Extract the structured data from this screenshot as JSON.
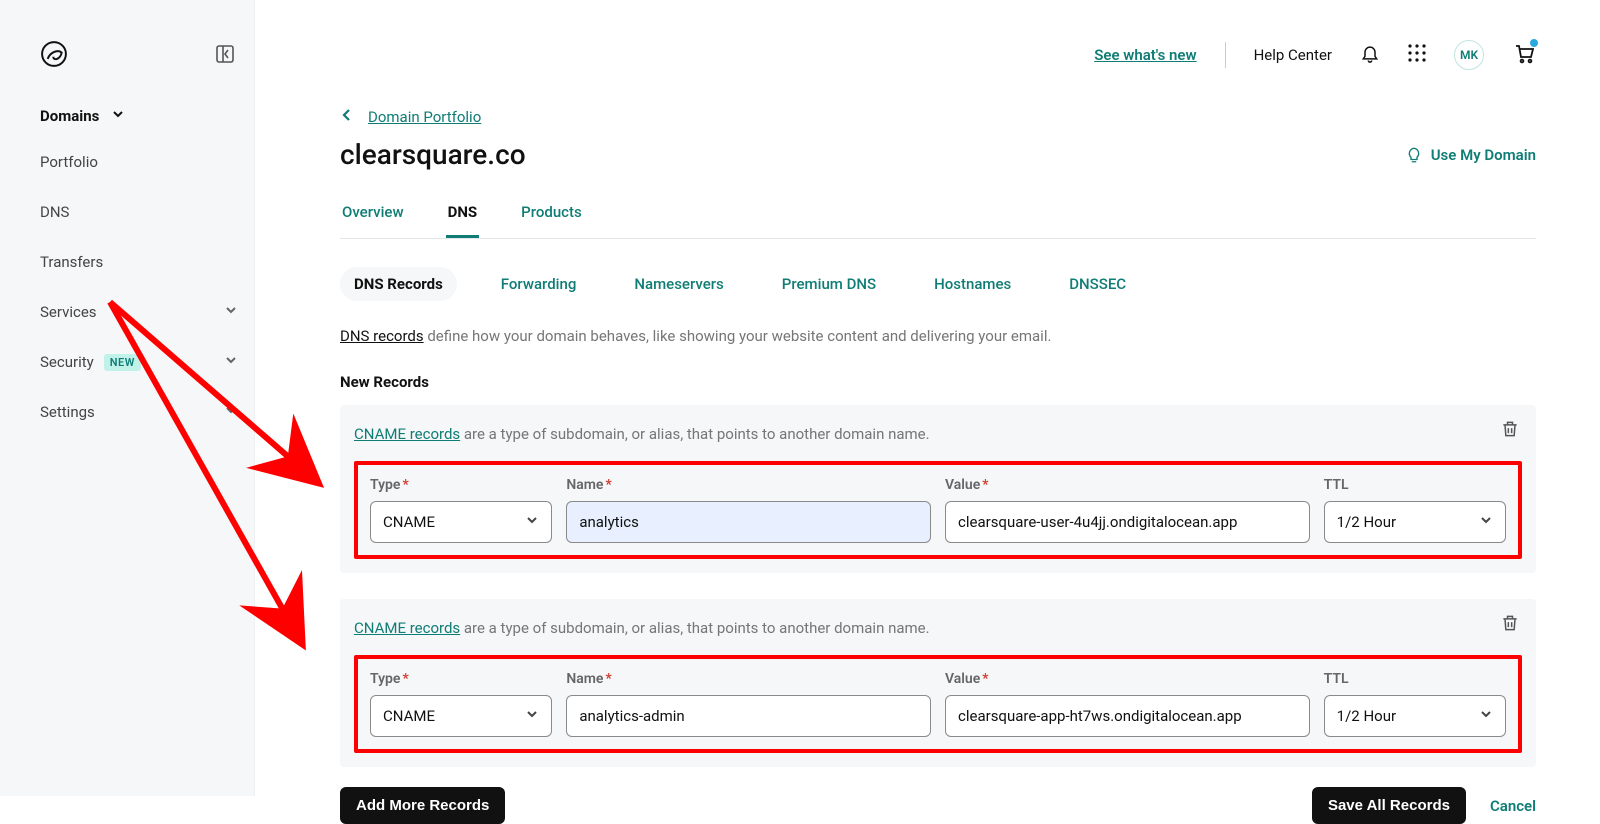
{
  "sidebar": {
    "section_title": "Domains",
    "items": [
      {
        "label": "Portfolio"
      },
      {
        "label": "DNS"
      },
      {
        "label": "Transfers"
      },
      {
        "label": "Services"
      },
      {
        "label": "Security",
        "badge": "NEW"
      },
      {
        "label": "Settings"
      }
    ]
  },
  "topbar": {
    "whats_new": "See what's new",
    "help_center": "Help Center",
    "avatar_initials": "MK"
  },
  "breadcrumb": {
    "back_label": "Domain Portfolio"
  },
  "domain": {
    "name": "clearsquare.co",
    "use_domain_label": "Use My Domain"
  },
  "tabs": [
    {
      "label": "Overview"
    },
    {
      "label": "DNS"
    },
    {
      "label": "Products"
    }
  ],
  "subtabs": [
    {
      "label": "DNS Records"
    },
    {
      "label": "Forwarding"
    },
    {
      "label": "Nameservers"
    },
    {
      "label": "Premium DNS"
    },
    {
      "label": "Hostnames"
    },
    {
      "label": "DNSSEC"
    }
  ],
  "info": {
    "link_text": "DNS records",
    "rest": " define how your domain behaves, like showing your website content and delivering your email."
  },
  "new_records_label": "New Records",
  "cname_tip": {
    "link": "CNAME records",
    "rest": " are a type of subdomain, or alias, that points to another domain name."
  },
  "field_labels": {
    "type": "Type",
    "name": "Name",
    "value": "Value",
    "ttl": "TTL"
  },
  "records": [
    {
      "type": "CNAME",
      "name": "analytics",
      "value": "clearsquare-user-4u4jj.ondigitalocean.app",
      "ttl": "1/2 Hour",
      "highlight_name": true
    },
    {
      "type": "CNAME",
      "name": "analytics-admin",
      "value": "clearsquare-app-ht7ws.ondigitalocean.app",
      "ttl": "1/2 Hour",
      "highlight_name": false
    }
  ],
  "buttons": {
    "add_more": "Add More Records",
    "save_all": "Save All Records",
    "cancel": "Cancel"
  }
}
